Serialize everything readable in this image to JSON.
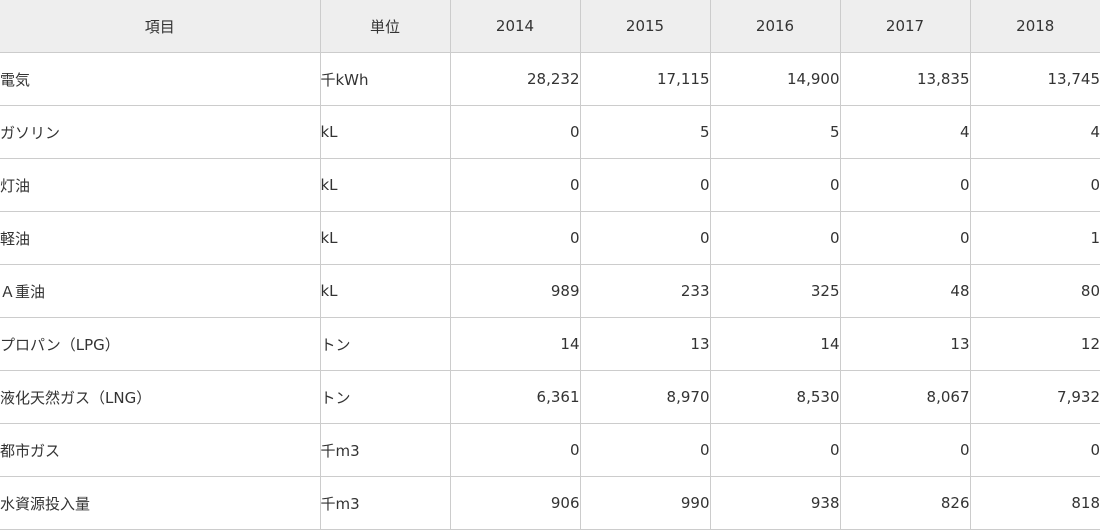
{
  "table": {
    "headers": [
      "項目",
      "単位",
      "2014",
      "2015",
      "2016",
      "2017",
      "2018"
    ],
    "rows": [
      {
        "item": "電気",
        "unit": "千kWh",
        "values": [
          "28,232",
          "17,115",
          "14,900",
          "13,835",
          "13,745"
        ]
      },
      {
        "item": "ガソリン",
        "unit": "kL",
        "values": [
          "0",
          "5",
          "5",
          "4",
          "4"
        ]
      },
      {
        "item": "灯油",
        "unit": "kL",
        "values": [
          "0",
          "0",
          "0",
          "0",
          "0"
        ]
      },
      {
        "item": "軽油",
        "unit": "kL",
        "values": [
          "0",
          "0",
          "0",
          "0",
          "1"
        ]
      },
      {
        "item": "Ａ重油",
        "unit": "kL",
        "values": [
          "989",
          "233",
          "325",
          "48",
          "80"
        ]
      },
      {
        "item": "プロパン（LPG）",
        "unit": "トン",
        "values": [
          "14",
          "13",
          "14",
          "13",
          "12"
        ]
      },
      {
        "item": "液化天然ガス（LNG）",
        "unit": "トン",
        "values": [
          "6,361",
          "8,970",
          "8,530",
          "8,067",
          "7,932"
        ]
      },
      {
        "item": "都市ガス",
        "unit": "千m3",
        "values": [
          "0",
          "0",
          "0",
          "0",
          "0"
        ]
      },
      {
        "item": "水資源投入量",
        "unit": "千m3",
        "values": [
          "906",
          "990",
          "938",
          "826",
          "818"
        ]
      }
    ]
  }
}
